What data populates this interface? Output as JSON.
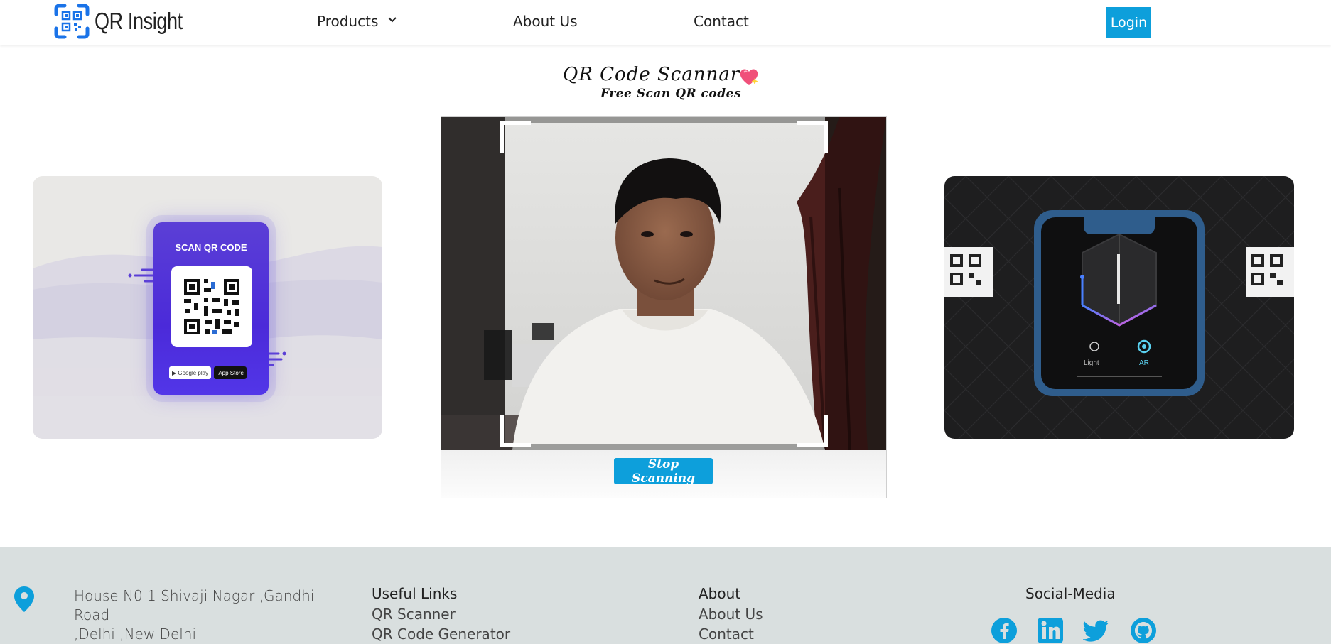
{
  "header": {
    "logo_text": "QR Insight",
    "nav": {
      "products": "Products",
      "about": "About Us",
      "contact": "Contact"
    },
    "login": "Login",
    "icons": {
      "products_chevron": "chevron-down-icon",
      "logo": "qr-logo-icon"
    }
  },
  "scanner": {
    "title": "QR Code Scannar",
    "title_emoji": "sparkling-heart-icon",
    "subtitle": "Free Scan QR codes",
    "stop_button": "Stop Scanning",
    "camera_state": "live camera preview with scan frame"
  },
  "cards": {
    "left": {
      "heading": "SCAN QR CODE",
      "store_badges": [
        "Google play",
        "App Store"
      ]
    },
    "right": {
      "modes": [
        "Light",
        "AR"
      ]
    }
  },
  "footer": {
    "address_line1": "House N0 1 Shivaji Nagar ,Gandhi Road",
    "address_line2": ",Delhi ,New Delhi",
    "useful_links": {
      "heading": "Useful Links",
      "items": [
        "QR Scanner",
        "QR Code Generator"
      ]
    },
    "about": {
      "heading": "About",
      "items": [
        "About Us",
        "Contact"
      ]
    },
    "social": {
      "heading": "Social-Media",
      "icons": [
        "facebook-icon",
        "linkedin-icon",
        "twitter-icon",
        "github-icon"
      ]
    }
  },
  "colors": {
    "accent": "#0d9fdb",
    "footer_bg": "#d9dfdf",
    "card_left_bg": "#e9e8e6",
    "card_right_bg": "#1e1e1f"
  }
}
